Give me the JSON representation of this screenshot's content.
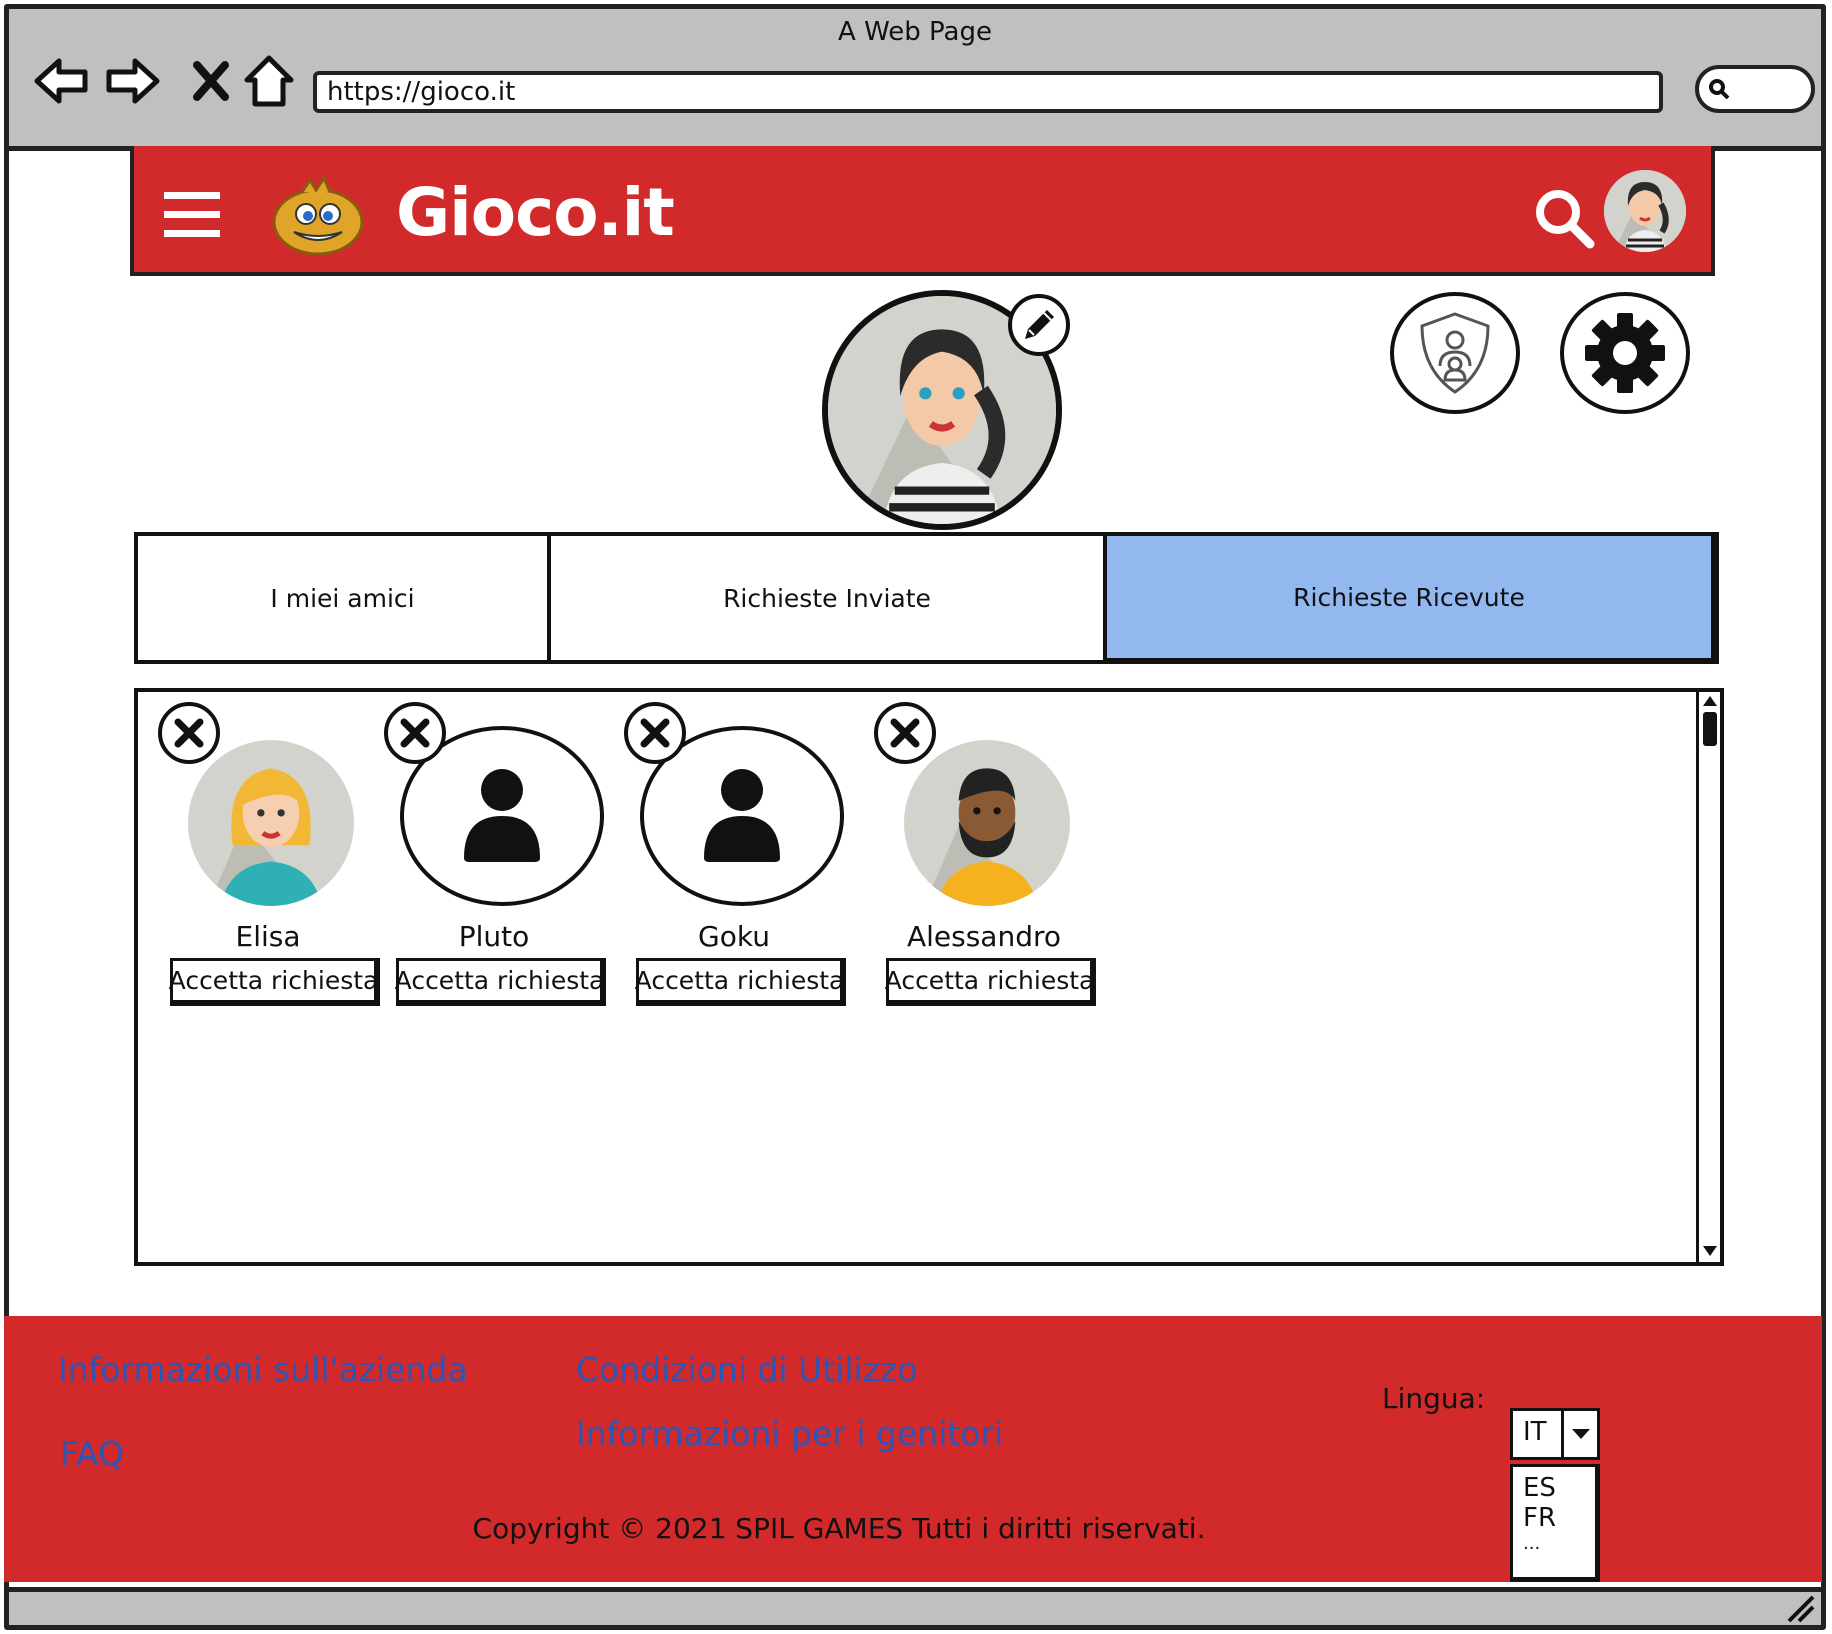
{
  "browser": {
    "title": "A Web Page",
    "url": "https://gioco.it"
  },
  "header": {
    "brand": "Gioco.it",
    "accent_color": "#d22a2a"
  },
  "tabs": [
    {
      "label": "I miei amici",
      "active": false
    },
    {
      "label": "Richieste Inviate",
      "active": false
    },
    {
      "label": "Richieste Ricevute",
      "active": true
    }
  ],
  "tab_active_color": "#93b8f0",
  "requests": [
    {
      "name": "Elisa",
      "accept_label": "Accetta richiesta"
    },
    {
      "name": "Pluto",
      "accept_label": "Accetta richiesta"
    },
    {
      "name": "Goku",
      "accept_label": "Accetta richiesta"
    },
    {
      "name": "Alessandro",
      "accept_label": "Accetta richiesta"
    }
  ],
  "footer": {
    "links": {
      "company": "Informazioni sull'azienda",
      "faq": "FAQ",
      "terms": "Condizioni di Utilizzo",
      "parents": "Informazioni per i genitori"
    },
    "language_label": "Lingua:",
    "language_selected": "IT",
    "language_options": [
      "ES",
      "FR",
      "..."
    ],
    "copyright": "Copyright © 2021 SPIL GAMES Tutti i diritti riservati."
  }
}
